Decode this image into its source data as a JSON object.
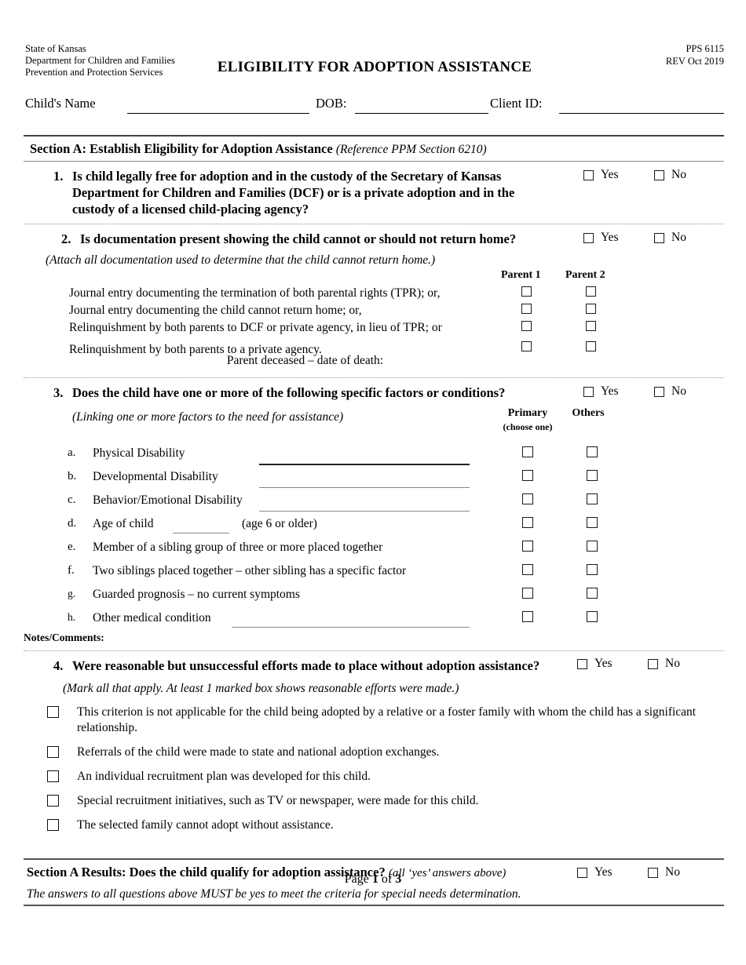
{
  "header": {
    "agency": [
      "State of Kansas",
      "Department for Children and Families",
      "Prevention and Protection Services"
    ],
    "title": "ELIGIBILITY FOR ADOPTION ASSISTANCE",
    "form_number": "PPS 6115",
    "revision": "REV Oct 2019"
  },
  "child_info": {
    "name_label": "Child's Name",
    "dob_label": "DOB:",
    "client_id_label": "Client ID:",
    "name_value": "",
    "dob_value": "",
    "client_id_value": ""
  },
  "section_a": {
    "heading": "Section A:  Establish Eligibility for Adoption Assistance",
    "reference": "(Reference PPM Section 6210)",
    "yes_label": "Yes",
    "no_label": "No",
    "questions": [
      {
        "number": "1.",
        "text": "Is child legally free for adoption and in the custody of the Secretary of Kansas Department for Children and Families (DCF) or is a private adoption and in the custody of a licensed child-placing agency?"
      },
      {
        "number": "2.",
        "text": "Is documentation present showing the child cannot or should not return home?",
        "note": "(Attach all documentation used to determine that the child cannot return home.)",
        "parent1_header": "Parent 1",
        "parent2_header": "Parent 2",
        "rows": [
          "Journal entry documenting the termination of both parental rights (TPR); or,",
          "Journal entry documenting the child cannot return home; or,",
          "Relinquishment by both parents to DCF or private agency, in lieu of TPR; or",
          "Relinquishment by both parents to a private agency."
        ],
        "deceased_label": "Parent deceased – date of death:"
      },
      {
        "number": "3.",
        "text": "Does the child have one or more of the following specific factors or conditions?",
        "note": "(Linking one or more factors to the need for assistance)",
        "primary_header": "Primary",
        "primary_subheader": "(choose one)",
        "others_header": "Others",
        "factors": [
          {
            "letter": "a.",
            "label": "Physical Disability",
            "has_blank": true
          },
          {
            "letter": "b.",
            "label": "Developmental Disability",
            "has_blank": true
          },
          {
            "letter": "c.",
            "label": "Behavior/Emotional Disability",
            "has_blank": true
          },
          {
            "letter": "d.",
            "label": "Age of child",
            "suffix": "(age 6 or older)",
            "has_blank": true
          },
          {
            "letter": "e.",
            "label": "Member of a sibling group of three or more placed together",
            "has_blank": false
          },
          {
            "letter": "f.",
            "label": "Two siblings placed together – other sibling has a specific factor",
            "has_blank": false
          },
          {
            "letter": "g.",
            "label": "Guarded prognosis – no current symptoms",
            "has_blank": false
          },
          {
            "letter": "h.",
            "label": "Other medical condition",
            "has_blank": true
          }
        ],
        "notes_label": "Notes/Comments:"
      },
      {
        "number": "4.",
        "text": "Were reasonable but unsuccessful efforts made to place without adoption assistance?",
        "note": "(Mark all that apply.  At least 1 marked box shows reasonable efforts were made.)",
        "options": [
          "This criterion is not applicable for the child being adopted by a relative or a foster family with whom the child has a significant relationship.",
          "Referrals of the child were made to state and national adoption exchanges.",
          "An individual recruitment plan was developed for this child.",
          "Special recruitment initiatives, such as TV or newspaper, were made for this child.",
          "The selected family cannot adopt without assistance."
        ]
      }
    ],
    "results": {
      "heading": "Section A Results:  Does the child qualify for adoption assistance?",
      "paren": "(all ‘yes’ answers above)",
      "statement": "The answers to all questions above MUST be yes to meet the criteria for special needs determination."
    }
  },
  "footer": {
    "page_prefix": "Page ",
    "page_current": "1",
    "page_middle": " of ",
    "page_total": "3"
  }
}
